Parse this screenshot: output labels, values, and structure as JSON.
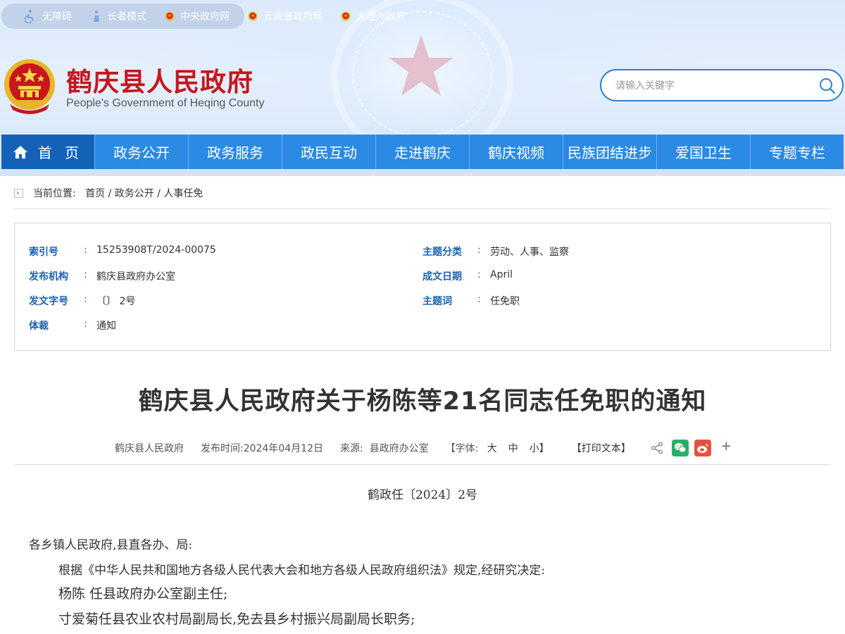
{
  "topbar": {
    "links": [
      {
        "label": "无障碍",
        "icon": "accessibility-icon"
      },
      {
        "label": "长者模式",
        "icon": "elder-mode-icon"
      },
      {
        "label": "中央政府网",
        "icon": "national-emblem-icon"
      },
      {
        "label": "云南省政府网",
        "icon": "national-emblem-icon"
      },
      {
        "label": "大理州政府",
        "icon": "national-emblem-icon"
      }
    ]
  },
  "header": {
    "title": "鹤庆县人民政府",
    "subtitle": "People's Government of Heqing County"
  },
  "search": {
    "placeholder": "请输入关键字",
    "value": "",
    "icon": "search-icon"
  },
  "nav": {
    "home": "首 页",
    "items": [
      "政务公开",
      "政务服务",
      "政民互动",
      "走进鹤庆",
      "鹤庆视频",
      "民族团结进步",
      "爱国卫生",
      "专题专栏"
    ]
  },
  "breadcrumb": {
    "prefix": "当前位置:",
    "items": [
      "首页",
      "政务公开",
      "人事任免"
    ],
    "separator": "/"
  },
  "meta": {
    "index_label": "索引号",
    "index_value": "15253908T/2024-00075",
    "topic_label": "主题分类",
    "topic_value": "劳动、人事、监察",
    "org_label": "发布机构",
    "org_value": "鹤庆县政府办公室",
    "date_label": "成文日期",
    "date_value": "April",
    "docno_label": "发文字号",
    "docno_value": "〔〕 2号",
    "keyword_label": "主题词",
    "keyword_value": "任免职",
    "genre_label": "体裁",
    "genre_value": "通知",
    "colon": ":"
  },
  "article": {
    "title": "鹤庆县人民政府关于杨陈等21名同志任免职的通知",
    "publisher": "鹤庆县人民政府",
    "publish_time": "发布时间:2024年04月12日",
    "source_label": "来源:",
    "source_value": "县政府办公室",
    "font_size_label": "【字体:",
    "font_big": "大",
    "font_mid": "中",
    "font_small": "小】",
    "print": "【打印文本】",
    "plus": "+",
    "doc_number": "鹤政任〔2024〕2号",
    "salutation": "各乡镇人民政府,县直各办、局:",
    "intro": "根据《中华人民共和国地方各级人民代表大会和地方各级人民政府组织法》规定,经研究决定:",
    "line1": "杨陈  任县政府办公室副主任;",
    "line2": "寸爱菊任县农业农村局副局长,免去县乡村振兴局副局长职务;"
  },
  "colors": {
    "nav_blue": "#2a8ae4",
    "nav_home": "#1462b8",
    "title_red": "#c4161c",
    "meta_blue": "#1a63b0",
    "wechat_green": "#2aae67",
    "weibo_red": "#e6513f"
  }
}
